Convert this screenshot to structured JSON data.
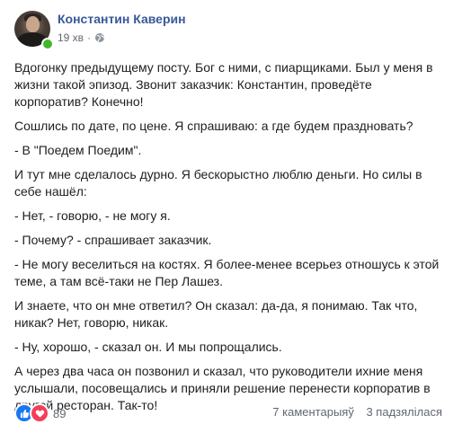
{
  "post": {
    "author": "Константин Каверин",
    "time": "19 хв",
    "separator": "·",
    "privacy_icon": "globe-icon",
    "paragraphs": [
      "Вдогонку предыдущему посту. Бог с ними, с пиарщиками. Был у меня в жизни такой эпизод. Звонит заказчик: Константин, проведёте корпоратив? Конечно!",
      "Сошлись по дате, по цене. Я спрашиваю: а где будем праздновать?",
      "- В \"Поедем Поедим\".",
      "И тут мне сделалось дурно. Я бескорыстно люблю деньги. Но силы в себе нашёл:",
      "- Нет, - говорю, - не могу я.",
      "- Почему? - спрашивает заказчик.",
      "- Не могу веселиться на костях. Я более-менее всерьез отношусь к этой теме, а там всё-таки не Пер Лашез.",
      "И знаете, что он мне ответил? Он сказал: да-да, я понимаю. Так что, никак? Нет, говорю, никак.",
      "- Ну, хорошо, - сказал он. И мы попрощались.",
      "А через два часа он позвонил и сказал, что руководители ихние меня услышали, посовещались и приняли решение перенести корпоратив в другой ресторан. Так-то!"
    ]
  },
  "footer": {
    "reaction_icons": [
      "like-icon",
      "love-icon"
    ],
    "reaction_count": "89",
    "comments": "7 каментарыяў",
    "shares": "3 падзялілася"
  },
  "colors": {
    "author": "#385898",
    "meta": "#616770",
    "online": "#42b72a",
    "like": "#1877f2",
    "love": "#f33e58"
  }
}
